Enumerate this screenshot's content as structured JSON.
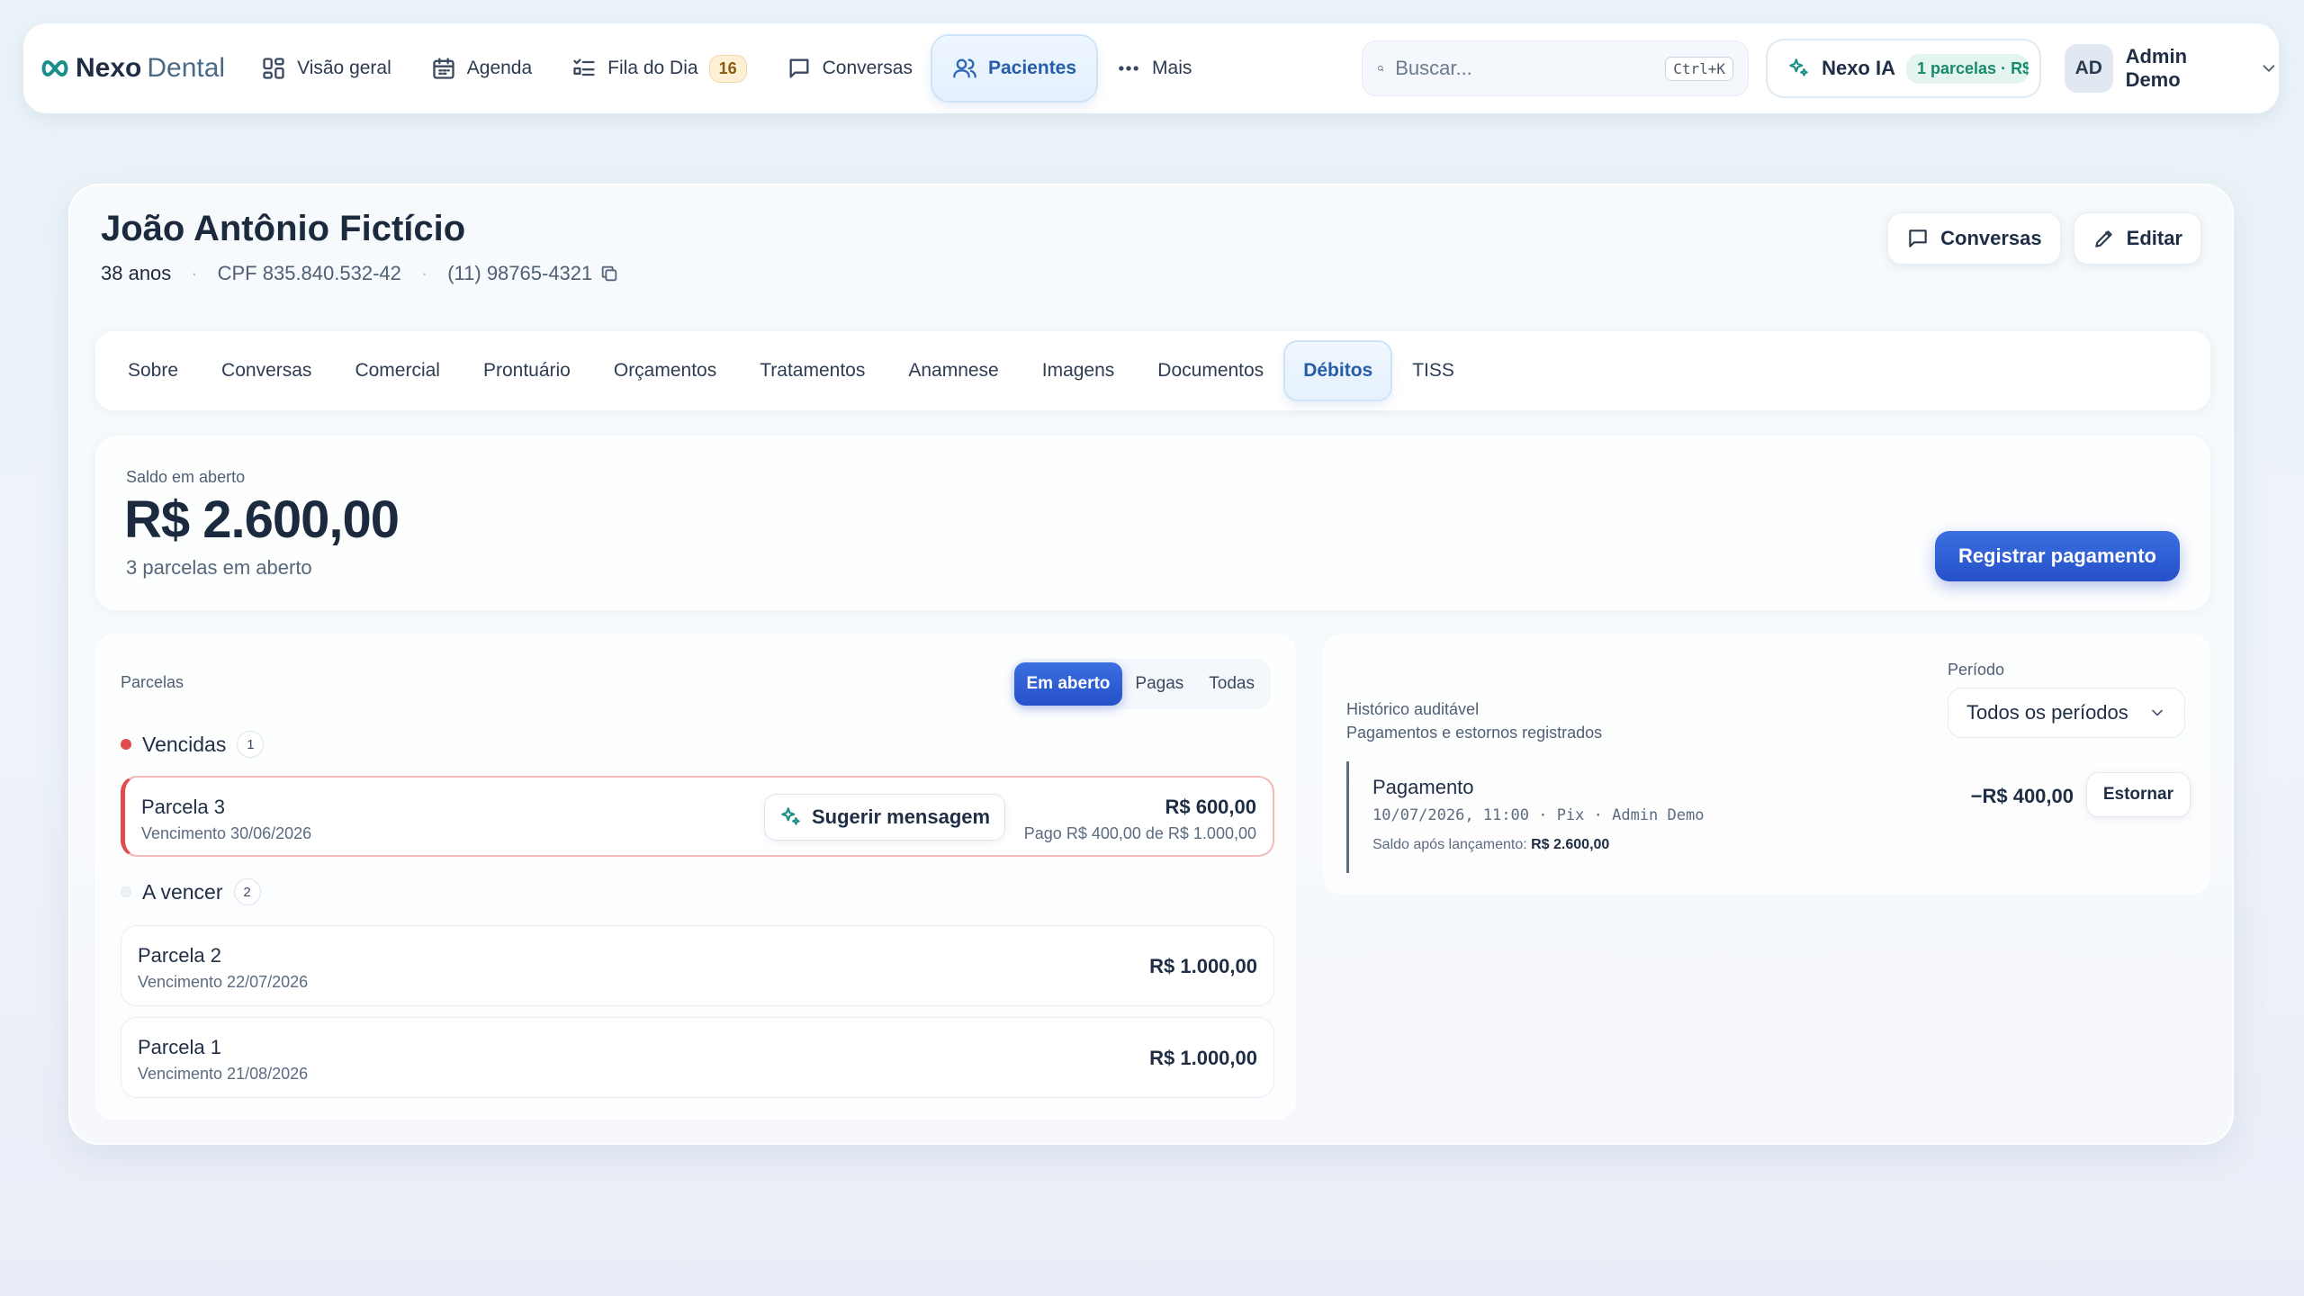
{
  "colors": {
    "accent": "#2550c9",
    "brand": "#1c8f8a",
    "overdue": "#e04b4b",
    "active_tab": "#245ea8"
  },
  "brand": {
    "name": "Nexo",
    "suffix": "Dental"
  },
  "nav": {
    "items": [
      {
        "label": "Visão geral",
        "icon": "grid-icon"
      },
      {
        "label": "Agenda",
        "icon": "calendar-icon"
      },
      {
        "label": "Fila do Dia",
        "icon": "list-icon",
        "badge": "16"
      },
      {
        "label": "Conversas",
        "icon": "chat-icon"
      },
      {
        "label": "Pacientes",
        "icon": "users-icon",
        "active": true
      },
      {
        "label": "Mais",
        "icon": "more-icon"
      }
    ]
  },
  "search": {
    "placeholder": "Buscar...",
    "shortcut": "Ctrl+K"
  },
  "ai": {
    "label": "Nexo IA",
    "chip": "1 parcelas · R$"
  },
  "user": {
    "initials": "AD",
    "name": "Admin Demo"
  },
  "patient": {
    "name": "João Antônio Fictício",
    "age": "38 anos",
    "cpf": "CPF 835.840.532-42",
    "phone": "(11) 98765-4321"
  },
  "actions": {
    "conversas": "Conversas",
    "editar": "Editar"
  },
  "tabs": [
    {
      "label": "Sobre"
    },
    {
      "label": "Conversas"
    },
    {
      "label": "Comercial"
    },
    {
      "label": "Prontuário"
    },
    {
      "label": "Orçamentos"
    },
    {
      "label": "Tratamentos"
    },
    {
      "label": "Anamnese"
    },
    {
      "label": "Imagens"
    },
    {
      "label": "Documentos"
    },
    {
      "label": "Débitos",
      "active": true
    },
    {
      "label": "TISS"
    }
  ],
  "balance": {
    "label": "Saldo em aberto",
    "value": "R$ 2.600,00",
    "subtitle": "3 parcelas em aberto",
    "button": "Registrar pagamento"
  },
  "installments": {
    "title": "Parcelas",
    "filters": [
      "Em aberto",
      "Pagas",
      "Todas"
    ],
    "overdue": {
      "label": "Vencidas",
      "count": "1",
      "items": [
        {
          "title": "Parcela 3",
          "due": "Vencimento 30/06/2026",
          "amount": "R$ 600,00",
          "paid": "Pago R$ 400,00 de R$ 1.000,00",
          "suggest": "Sugerir mensagem"
        }
      ]
    },
    "upcoming": {
      "label": "A vencer",
      "count": "2",
      "items": [
        {
          "title": "Parcela 2",
          "due": "Vencimento 22/07/2026",
          "amount": "R$ 1.000,00"
        },
        {
          "title": "Parcela 1",
          "due": "Vencimento 21/08/2026",
          "amount": "R$ 1.000,00"
        }
      ]
    }
  },
  "history": {
    "title": "Histórico auditável",
    "subtitle": "Pagamentos e estornos registrados",
    "period_label": "Período",
    "period_value": "Todos os períodos",
    "entries": [
      {
        "title": "Pagamento",
        "meta": "10/07/2026, 11:00 · Pix · Admin Demo",
        "balance_label": "Saldo após lançamento:",
        "balance_value": "R$ 2.600,00",
        "amount": "−R$ 400,00",
        "action": "Estornar"
      }
    ]
  }
}
